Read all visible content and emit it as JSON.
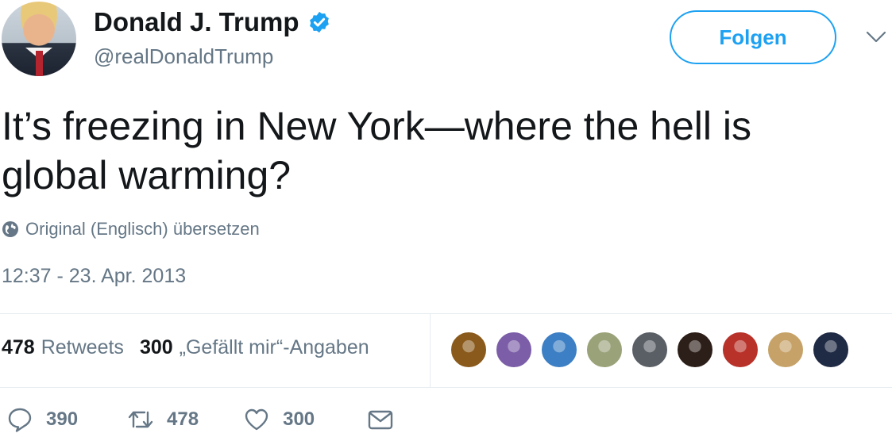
{
  "header": {
    "name": "Donald J. Trump",
    "handle": "@realDonaldTrump",
    "verified": true,
    "follow_label": "Folgen"
  },
  "tweet": {
    "text_line1": "It’s freezing in New York—where the hell is",
    "text_line2": "global warming?",
    "translate_label": "Original (Englisch) übersetzen",
    "timestamp": "12:37 - 23. Apr. 2013"
  },
  "stats": {
    "retweets_count": "478",
    "retweets_label": "Retweets",
    "likes_count": "300",
    "likes_label": "„Gefällt mir“-Angaben"
  },
  "likers": [
    {
      "color": "#8a5a1c"
    },
    {
      "color": "#7b5ea7"
    },
    {
      "color": "#3d7fc4"
    },
    {
      "color": "#9aa27a"
    },
    {
      "color": "#5a5f66"
    },
    {
      "color": "#2c1e18"
    },
    {
      "color": "#b8322a"
    },
    {
      "color": "#c6a268"
    },
    {
      "color": "#1f2a44"
    }
  ],
  "actions": {
    "reply_count": "390",
    "retweet_count": "478",
    "like_count": "300"
  },
  "colors": {
    "accent": "#1da1f2",
    "secondary_text": "#657786",
    "primary_text": "#14171a",
    "divider": "#e6ecf0"
  },
  "icons": [
    "verified-badge-icon",
    "chevron-down-icon",
    "globe-icon",
    "reply-icon",
    "retweet-icon",
    "heart-icon",
    "message-icon"
  ]
}
